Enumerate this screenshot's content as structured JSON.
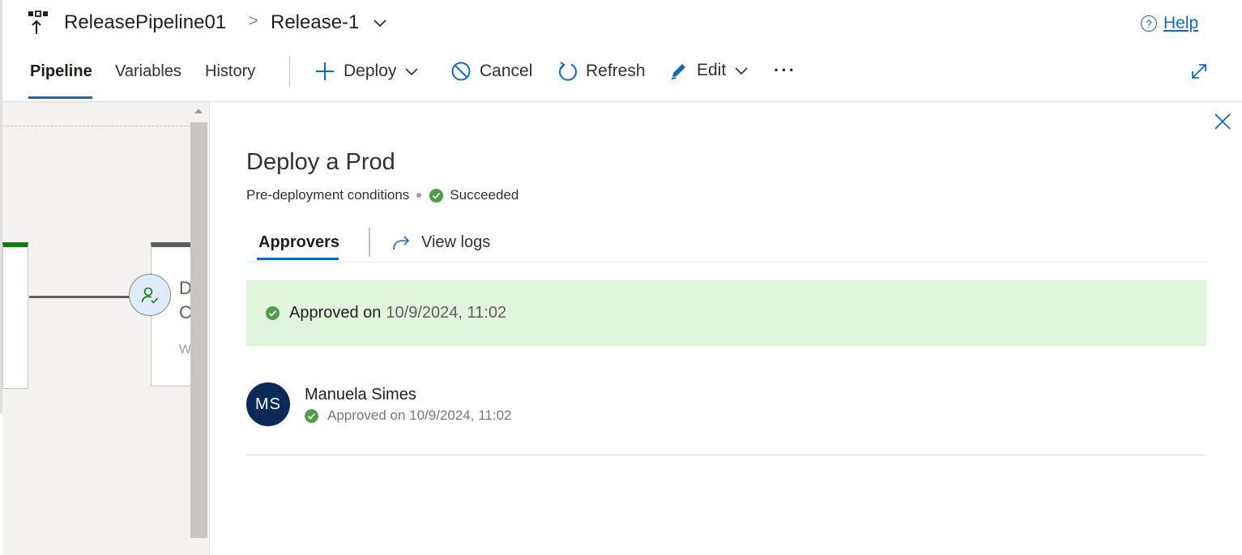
{
  "header": {
    "pipeline_name": "ReleasePipeline01",
    "release_name": "Release-1",
    "separator": ">",
    "help_label": "Help",
    "help_icon_glyph": "?",
    "icons": [
      "pipeline-icon",
      "chevron-right-icon",
      "chevron-down-icon",
      "help-circle-icon"
    ]
  },
  "toolbar": {
    "tabs": [
      {
        "label": "Pipeline",
        "active": true
      },
      {
        "label": "Variables",
        "active": false
      },
      {
        "label": "History",
        "active": false
      }
    ],
    "commands": {
      "deploy": "Deploy",
      "cancel": "Cancel",
      "refresh": "Refresh",
      "edit": "Edit",
      "more": "···"
    }
  },
  "canvas": {
    "stage2_line1": "D",
    "stage2_line2": "C",
    "stage2_line3": "W",
    "stage1_status_color": "#107c10"
  },
  "panel": {
    "title": "Deploy a Prod",
    "conditions_label": "Pre-deployment conditions",
    "status": "Succeeded",
    "tabs": {
      "approvers": "Approvers",
      "view_logs": "View logs"
    },
    "banner": {
      "text": "Approved on",
      "date": "10/9/2024, 11:02"
    },
    "approver": {
      "initials": "MS",
      "name": "Manuela Simes",
      "status": "Approved on 10/9/2024, 11:02"
    }
  },
  "colors": {
    "accent": "#0f6cbd",
    "success": "#4f9d48",
    "banner_bg": "#dff6dd",
    "avatar_bg": "#0b2a5a"
  }
}
